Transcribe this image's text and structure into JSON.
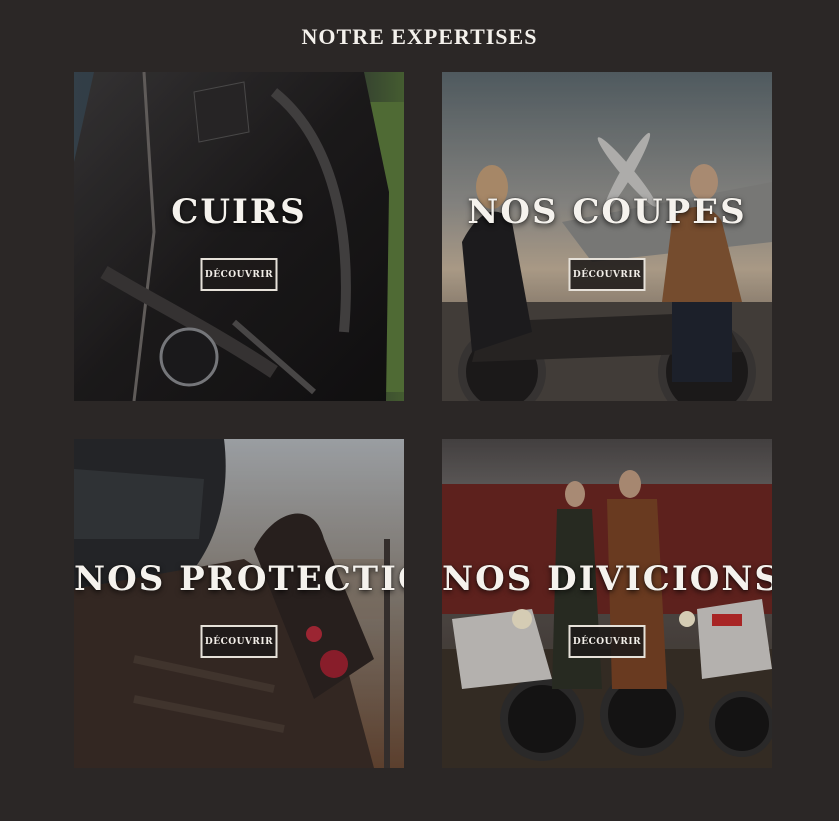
{
  "section": {
    "title": "NOTRE EXPERTISES"
  },
  "tiles": [
    {
      "label": "CUIRS",
      "button": "DÉCOUVRIR",
      "image": "leather-jacket-rider-photo"
    },
    {
      "label": "NOS COUPES",
      "button": "DÉCOUVRIR",
      "image": "couple-motorcycle-airplane-photo"
    },
    {
      "label": "NOS PROTECTIONS",
      "button": "DÉCOUVRIR",
      "image": "helmet-gloves-rider-photo"
    },
    {
      "label": "NOS DIVICIONS",
      "button": "DÉCOUVRIR",
      "image": "couple-motorcycles-red-truck-photo"
    }
  ],
  "colors": {
    "background": "#2b2726",
    "text": "#f5f2ed",
    "button_border": "#e6e1d9"
  }
}
